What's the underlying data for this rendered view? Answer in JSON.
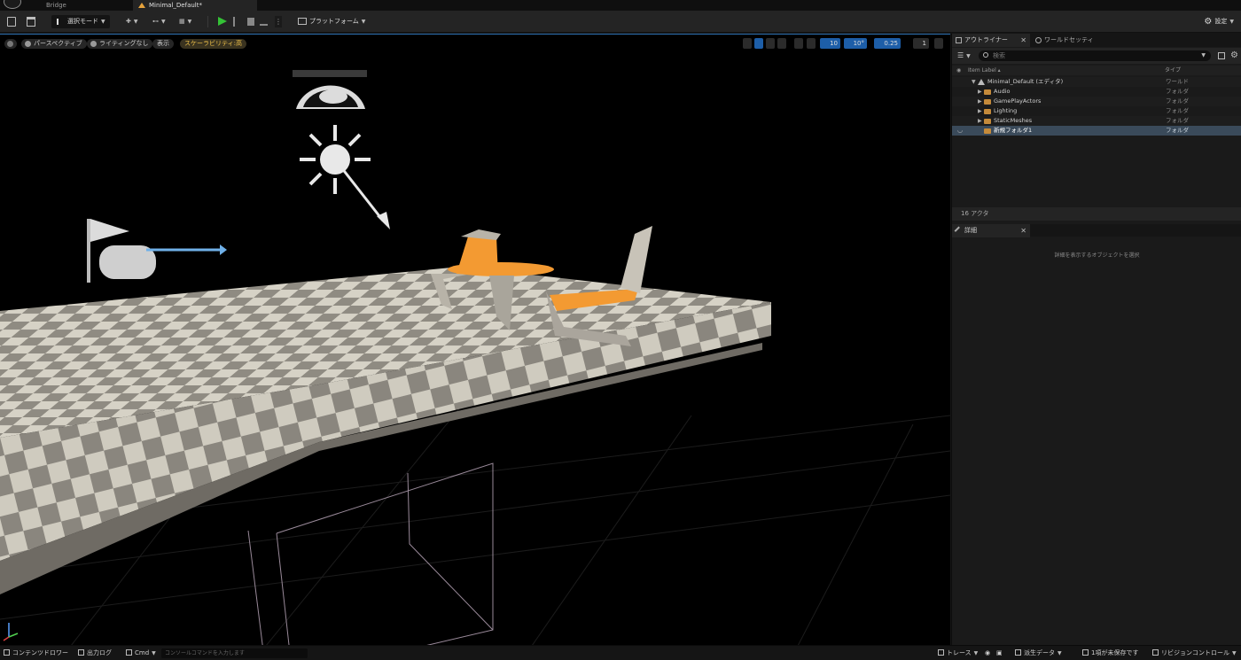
{
  "title_tabs": {
    "bridge": "Bridge",
    "level": "Minimal_Default*"
  },
  "toolbar": {
    "mode": "選択モード",
    "platform": "プラットフォーム",
    "settings": "設定"
  },
  "viewport": {
    "perspective": "パースペクティブ",
    "lighting": "ライティングなし",
    "show": "表示",
    "scalability": "スケーラビリティ:高",
    "grid_snap": "10",
    "rotation_snap": "10°",
    "scale_snap": "0.25",
    "camera_speed": "1"
  },
  "outliner": {
    "tab_label": "アウトライナー",
    "world_tab_label": "ワールドセッティ",
    "search_placeholder": "検索",
    "col_label": "Item Label ▴",
    "col_type": "タイプ",
    "rows": [
      {
        "label": "Minimal_Default (エディタ)",
        "type": "ワールド"
      },
      {
        "label": "Audio",
        "type": "フォルダ"
      },
      {
        "label": "GamePlayActors",
        "type": "フォルダ"
      },
      {
        "label": "Lighting",
        "type": "フォルダ"
      },
      {
        "label": "StaticMeshes",
        "type": "フォルダ"
      },
      {
        "label": "新規フォルダ1",
        "type": "フォルダ"
      }
    ],
    "actor_count": "16 アクタ"
  },
  "details": {
    "tab_label": "詳細",
    "empty_message": "詳細を表示するオブジェクトを選択"
  },
  "statusbar": {
    "content_drawer": "コンテンツドロワー",
    "output_log": "出力ログ",
    "cmd": "Cmd",
    "console_placeholder": "コンソールコマンドを入力します",
    "trace": "トレース",
    "derived_data": "派生データ",
    "unsaved": "1項が未保存です",
    "revision_control": "リビジョンコントロール"
  },
  "colors": {
    "accent_blue": "#1d5ea8",
    "play_green": "#34c236",
    "folder_orange": "#c58a3a",
    "scalability_yellow": "#f0c24a"
  }
}
